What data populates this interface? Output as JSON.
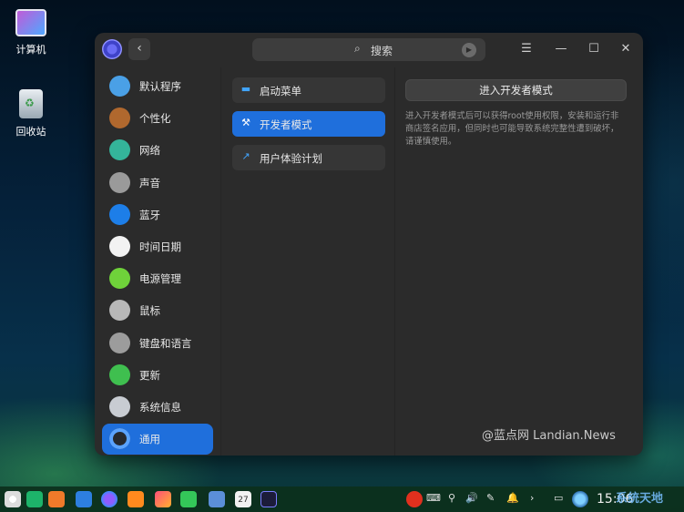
{
  "desktop": {
    "icons": [
      {
        "label": "计算机"
      },
      {
        "label": "回收站"
      }
    ]
  },
  "window": {
    "search_placeholder": "搜索",
    "controls": {
      "menu": "☰",
      "minimize": "—",
      "maximize": "☐",
      "close": "✕"
    },
    "back_glyph": "‹",
    "sidebar": [
      {
        "label": "默认程序",
        "icon": "default-apps-icon",
        "color": "#4aa0e6"
      },
      {
        "label": "个性化",
        "icon": "personalization-icon",
        "color": "#b0682e"
      },
      {
        "label": "网络",
        "icon": "network-icon",
        "color": "#34b49a"
      },
      {
        "label": "声音",
        "icon": "sound-icon",
        "color": "#9a9a9a"
      },
      {
        "label": "蓝牙",
        "icon": "bluetooth-icon",
        "color": "#1d7ee8"
      },
      {
        "label": "时间日期",
        "icon": "clock-icon",
        "color": "#f2f2f2"
      },
      {
        "label": "电源管理",
        "icon": "battery-icon",
        "color": "#6fd23a"
      },
      {
        "label": "鼠标",
        "icon": "mouse-icon",
        "color": "#b8b8b8"
      },
      {
        "label": "键盘和语言",
        "icon": "keyboard-icon",
        "color": "#9c9c9c"
      },
      {
        "label": "更新",
        "icon": "update-icon",
        "color": "#3fbf4f"
      },
      {
        "label": "系统信息",
        "icon": "system-info-icon",
        "color": "#c8ccd2"
      },
      {
        "label": "通用",
        "icon": "general-icon",
        "color": "#26292e",
        "active": true
      }
    ],
    "middle": [
      {
        "label": "启动菜单",
        "icon": "boot-menu-icon",
        "glyph": "▬"
      },
      {
        "label": "开发者模式",
        "icon": "developer-tools-icon",
        "glyph": "⚒",
        "active": true
      },
      {
        "label": "用户体验计划",
        "icon": "trend-icon",
        "glyph": "↗"
      }
    ],
    "content": {
      "button_label": "进入开发者模式",
      "description": "进入开发者模式后可以获得root使用权限，安装和运行非商店签名应用，但同时也可能导致系统完整性遭到破坏，请谨慎使用。",
      "watermark": "@蓝点网 Landian.News"
    }
  },
  "taskbar": {
    "clock": "15:06",
    "calendar_day": "27",
    "tray_glyphs": [
      "⌨",
      "⚲",
      "🔊",
      "✎",
      "🔔",
      "›",
      "▭"
    ],
    "corner_text": "系统天地"
  }
}
